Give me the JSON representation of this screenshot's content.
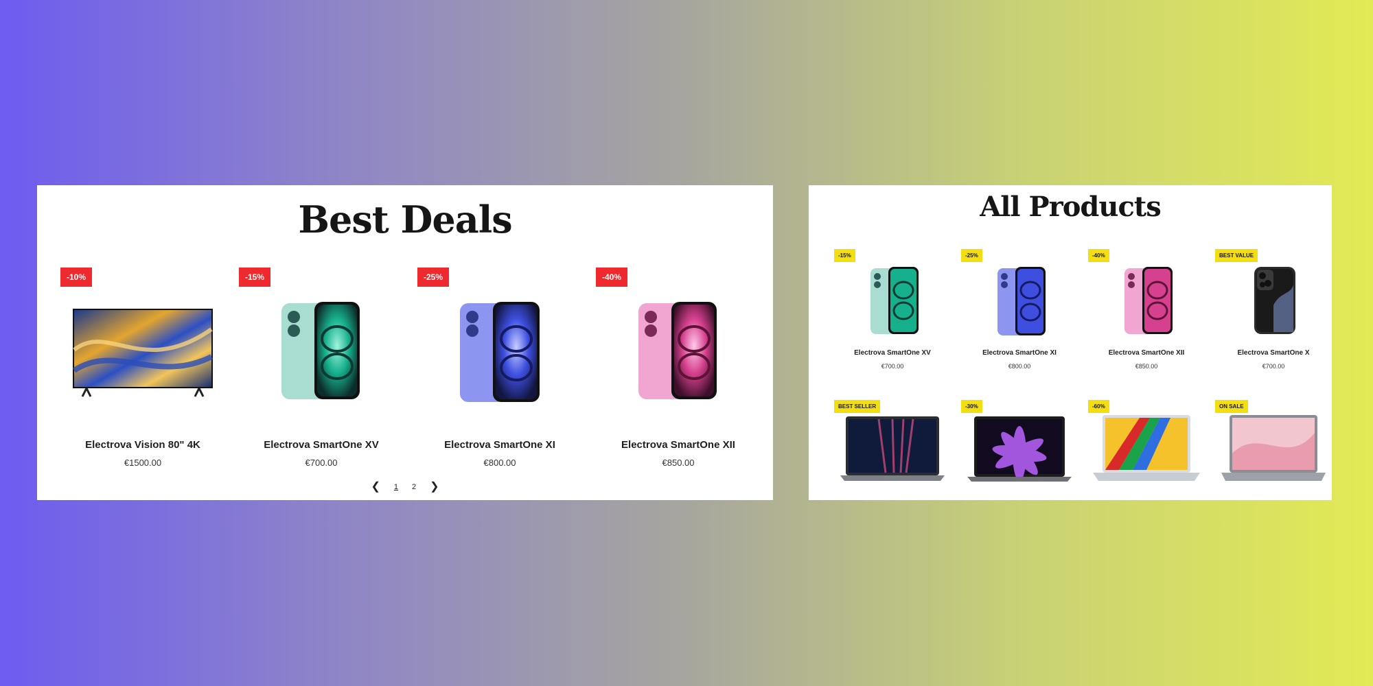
{
  "best_deals": {
    "title": "Best Deals",
    "items": [
      {
        "badge": "-10%",
        "name": "Electrova Vision 80\" 4K",
        "price": "€1500.00",
        "image": "tv-image"
      },
      {
        "badge": "-15%",
        "name": "Electrova SmartOne XV",
        "price": "€700.00",
        "image": "phone-teal-image",
        "color": "#36c9ad"
      },
      {
        "badge": "-25%",
        "name": "Electrova SmartOne XI",
        "price": "€800.00",
        "image": "phone-blue-image",
        "color": "#4b5ae8"
      },
      {
        "badge": "-40%",
        "name": "Electrova SmartOne XII",
        "price": "€850.00",
        "image": "phone-pink-image",
        "color": "#d84f9d"
      }
    ],
    "pagination": {
      "prev_icon": "chevron-left-icon",
      "pages": [
        "1",
        "2"
      ],
      "active_page": "1",
      "next_icon": "chevron-right-icon"
    }
  },
  "all_products": {
    "title": "All Products",
    "items": [
      {
        "badge": "-15%",
        "name": "Electrova SmartOne XV",
        "price": "€700.00",
        "image": "phone-teal-image"
      },
      {
        "badge": "-25%",
        "name": "Electrova SmartOne XI",
        "price": "€800.00",
        "image": "phone-blue-image"
      },
      {
        "badge": "-40%",
        "name": "Electrova SmartOne XII",
        "price": "€850.00",
        "image": "phone-pink-image"
      },
      {
        "badge": "BEST VALUE",
        "name": "Electrova SmartOne X",
        "price": "€700.00",
        "image": "phone-black-image"
      },
      {
        "badge": "BEST SELLER",
        "image": "laptop-dark-image"
      },
      {
        "badge": "-30%",
        "image": "laptop-purple-image"
      },
      {
        "badge": "-60%",
        "image": "laptop-colorful-image"
      },
      {
        "badge": "ON SALE",
        "image": "laptop-pink-image"
      }
    ]
  },
  "colors": {
    "deal_badge": "#ee2a2e",
    "product_badge": "#f3de12",
    "gradient_start": "#6d5cf0",
    "gradient_end": "#e2ea55"
  }
}
